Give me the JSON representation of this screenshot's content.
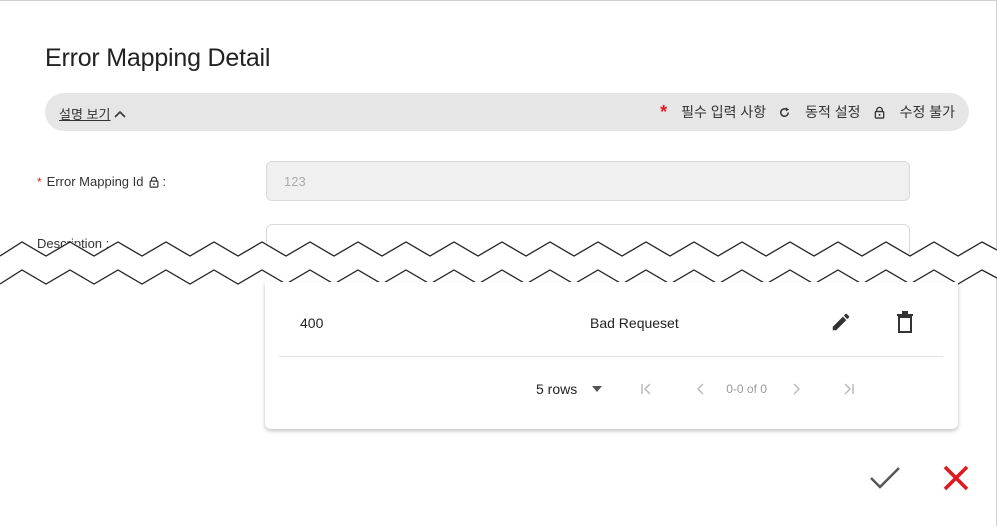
{
  "dialog": {
    "title": "Error Mapping Detail"
  },
  "legend": {
    "toggle_label": "설명 보기",
    "required_label": "필수 입력 사항",
    "dynamic_label": "동적 설정",
    "readonly_label": "수정 불가",
    "required_symbol": "*"
  },
  "form": {
    "error_mapping_id": {
      "label": "Error Mapping Id",
      "colon": ":",
      "value": "123",
      "required": true
    },
    "description": {
      "label": "Description :",
      "value": ""
    }
  },
  "table": {
    "rows": [
      {
        "code": "400",
        "message": "Bad Requeset"
      }
    ]
  },
  "pagination": {
    "rows_label": "5 rows",
    "range_label": "0-0 of 0"
  },
  "colors": {
    "accent_red": "#e0181f",
    "legend_bg": "#e6e6e6",
    "confirm_gray": "#555555"
  },
  "icons": {
    "toggle": "chevron-up-icon",
    "dynamic": "refresh-icon",
    "readonly": "lock-icon",
    "edit": "pencil-icon",
    "delete": "trash-icon",
    "confirm": "check-icon",
    "cancel": "close-icon"
  }
}
